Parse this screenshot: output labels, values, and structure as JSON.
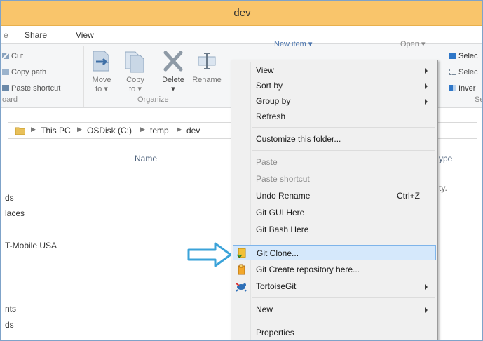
{
  "window": {
    "title": "dev"
  },
  "tabs": {
    "partial": "e",
    "share": "Share",
    "view": "View"
  },
  "ribbon": {
    "clipboard": {
      "cut": "Cut",
      "copy_path": "Copy path",
      "paste_shortcut": "Paste shortcut",
      "group_label": "oard"
    },
    "organize": {
      "move_to": "Move",
      "move_to_sub": "to ▾",
      "copy_to": "Copy",
      "copy_to_sub": "to ▾",
      "delete": "Delete",
      "rename": "Rename",
      "group_label": "Organize"
    },
    "new_item": "New item ▾",
    "open": "Open ▾",
    "select": {
      "select_all": "Selec",
      "select_none": "Selec",
      "invert": "Inver",
      "group_label": "Se"
    }
  },
  "address": {
    "crumbs": [
      "This PC",
      "OSDisk (C:)",
      "temp",
      "dev"
    ]
  },
  "columns": {
    "name": "Name",
    "type": "ype"
  },
  "empty_text": "ty.",
  "nav": {
    "items": [
      "ds",
      "laces",
      "T-Mobile USA",
      "nts",
      "ds"
    ]
  },
  "context_menu": {
    "items": [
      {
        "label": "View",
        "submenu": true
      },
      {
        "label": "Sort by",
        "submenu": true
      },
      {
        "label": "Group by",
        "submenu": true
      },
      {
        "label": "Refresh"
      },
      {
        "label": "Customize this folder..."
      },
      {
        "label": "Paste",
        "disabled": true
      },
      {
        "label": "Paste shortcut",
        "disabled": true
      },
      {
        "label": "Undo Rename",
        "shortcut": "Ctrl+Z"
      },
      {
        "label": "Git GUI Here"
      },
      {
        "label": "Git Bash Here"
      },
      {
        "label": "Git Clone...",
        "icon": "git-clone-icon"
      },
      {
        "label": "Git Create repository here...",
        "icon": "git-create-repo-icon"
      },
      {
        "label": "TortoiseGit",
        "icon": "tortoisegit-icon",
        "submenu": true
      },
      {
        "label": "New",
        "submenu": true
      },
      {
        "label": "Properties"
      }
    ]
  },
  "colors": {
    "titlebar": "#f9c56b",
    "highlight": "#d5e8fb",
    "arrow": "#3ba3d9"
  }
}
